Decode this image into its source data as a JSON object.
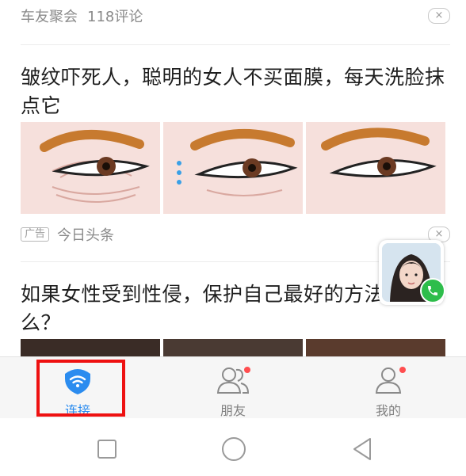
{
  "feed": {
    "item1": {
      "source": "车友聚会",
      "comments": "118评论",
      "close": "×"
    },
    "item2": {
      "title": "皱纹吓死人，聪明的女人不买面膜，每天洗脸抹点它",
      "tag": "广告",
      "source": "今日头条",
      "close": "×"
    },
    "item3": {
      "title": "如果女性受到性侵，保护自己最好的方法是什么？"
    }
  },
  "tabs": [
    {
      "label": "连接",
      "icon": "wifi-icon",
      "active": true
    },
    {
      "label": "朋友",
      "icon": "friends-icon",
      "active": false,
      "badge": true
    },
    {
      "label": "我的",
      "icon": "profile-icon",
      "active": false,
      "badge": true
    }
  ],
  "colors": {
    "accent": "#2b8cef",
    "badge": "#ff4d4f",
    "highlight": "#ee1111",
    "call": "#2ebd4b"
  }
}
